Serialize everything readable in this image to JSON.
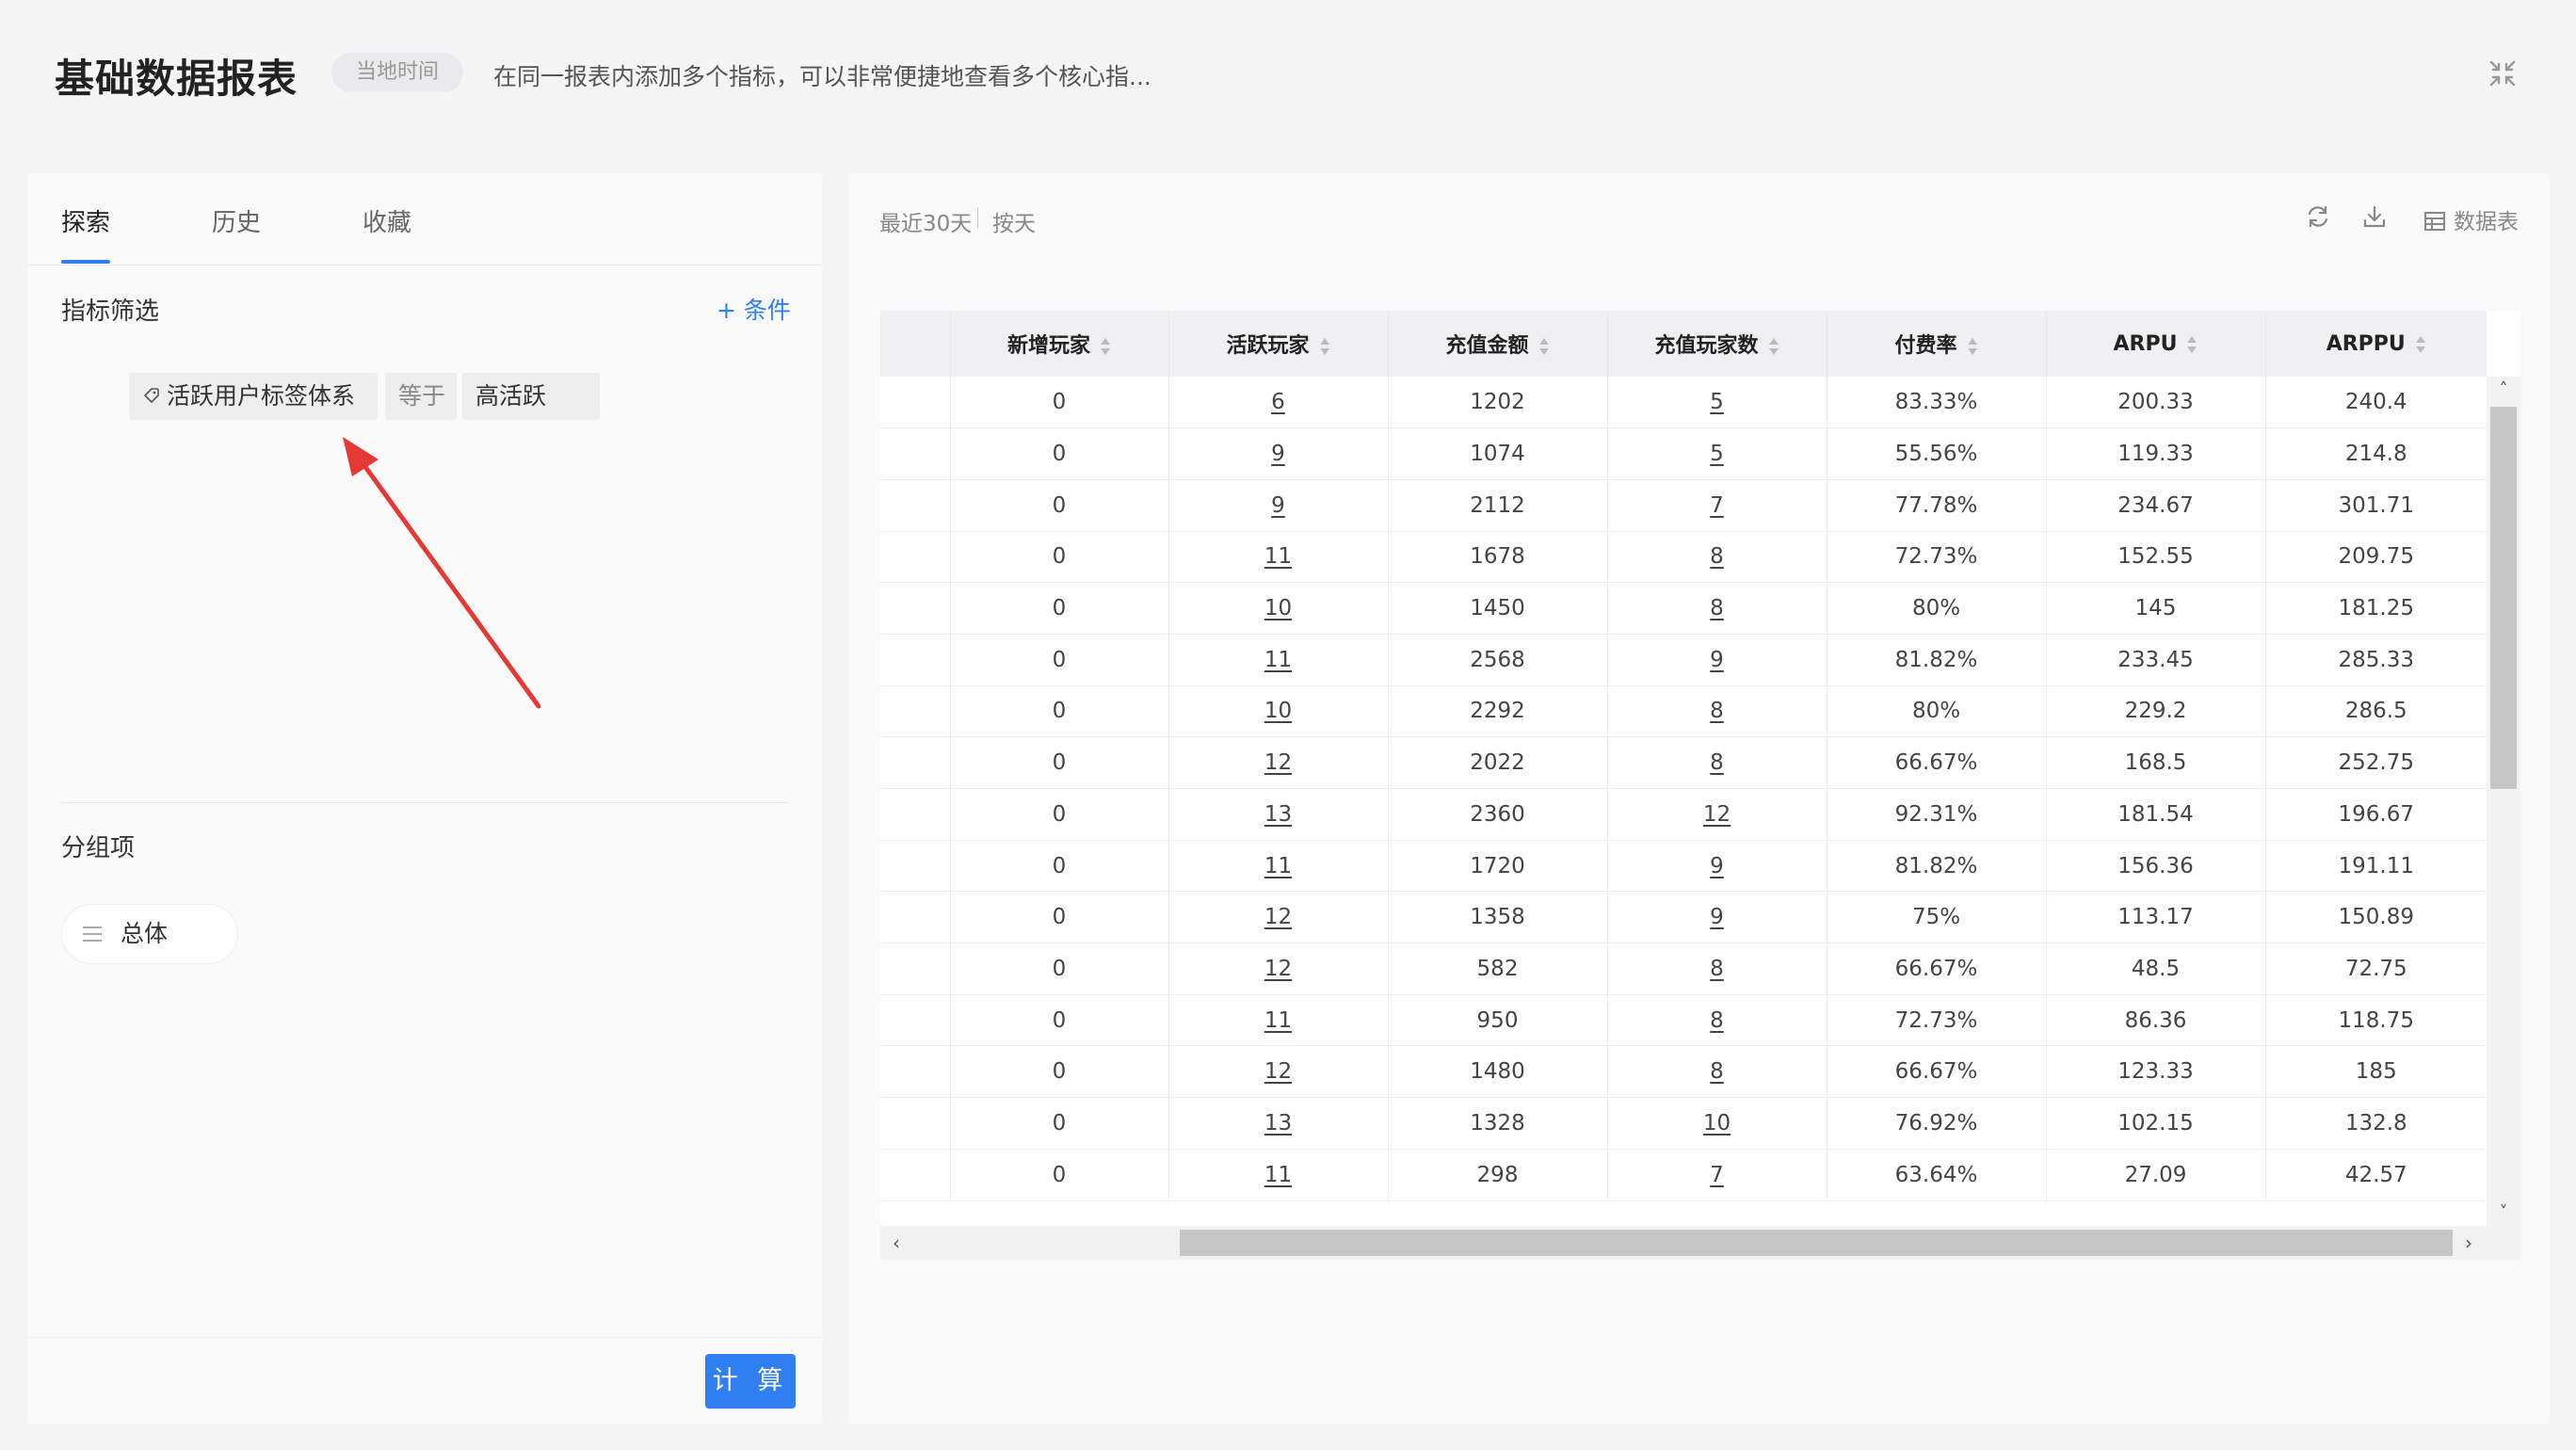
{
  "header": {
    "title": "基础数据报表",
    "time_tag": "当地时间",
    "description": "在同一报表内添加多个指标，可以非常便捷地查看多个核心指..."
  },
  "left": {
    "tabs": [
      "探索",
      "历史",
      "收藏"
    ],
    "filter_label": "指标筛选",
    "add_condition": "+ 条件",
    "filter": {
      "field": "活跃用户标签体系",
      "operator": "等于",
      "value": "高活跃"
    },
    "group_label": "分组项",
    "group_value": "总体",
    "calc_button": "计 算"
  },
  "right": {
    "date_range": "最近30天",
    "granularity": "按天",
    "table_toggle": "数据表"
  },
  "colors": {
    "accent": "#2f7ff0",
    "arrow": "#e53935"
  },
  "table": {
    "columns": [
      "新增玩家",
      "活跃玩家",
      "充值金额",
      "充值玩家数",
      "付费率",
      "ARPU",
      "ARPPU"
    ],
    "rows": [
      [
        "0",
        "6",
        "1202",
        "5",
        "83.33%",
        "200.33",
        "240.4"
      ],
      [
        "0",
        "9",
        "1074",
        "5",
        "55.56%",
        "119.33",
        "214.8"
      ],
      [
        "0",
        "9",
        "2112",
        "7",
        "77.78%",
        "234.67",
        "301.71"
      ],
      [
        "0",
        "11",
        "1678",
        "8",
        "72.73%",
        "152.55",
        "209.75"
      ],
      [
        "0",
        "10",
        "1450",
        "8",
        "80%",
        "145",
        "181.25"
      ],
      [
        "0",
        "11",
        "2568",
        "9",
        "81.82%",
        "233.45",
        "285.33"
      ],
      [
        "0",
        "10",
        "2292",
        "8",
        "80%",
        "229.2",
        "286.5"
      ],
      [
        "0",
        "12",
        "2022",
        "8",
        "66.67%",
        "168.5",
        "252.75"
      ],
      [
        "0",
        "13",
        "2360",
        "12",
        "92.31%",
        "181.54",
        "196.67"
      ],
      [
        "0",
        "11",
        "1720",
        "9",
        "81.82%",
        "156.36",
        "191.11"
      ],
      [
        "0",
        "12",
        "1358",
        "9",
        "75%",
        "113.17",
        "150.89"
      ],
      [
        "0",
        "12",
        "582",
        "8",
        "66.67%",
        "48.5",
        "72.75"
      ],
      [
        "0",
        "11",
        "950",
        "8",
        "72.73%",
        "86.36",
        "118.75"
      ],
      [
        "0",
        "12",
        "1480",
        "8",
        "66.67%",
        "123.33",
        "185"
      ],
      [
        "0",
        "13",
        "1328",
        "10",
        "76.92%",
        "102.15",
        "132.8"
      ],
      [
        "0",
        "11",
        "298",
        "7",
        "63.64%",
        "27.09",
        "42.57"
      ]
    ]
  }
}
